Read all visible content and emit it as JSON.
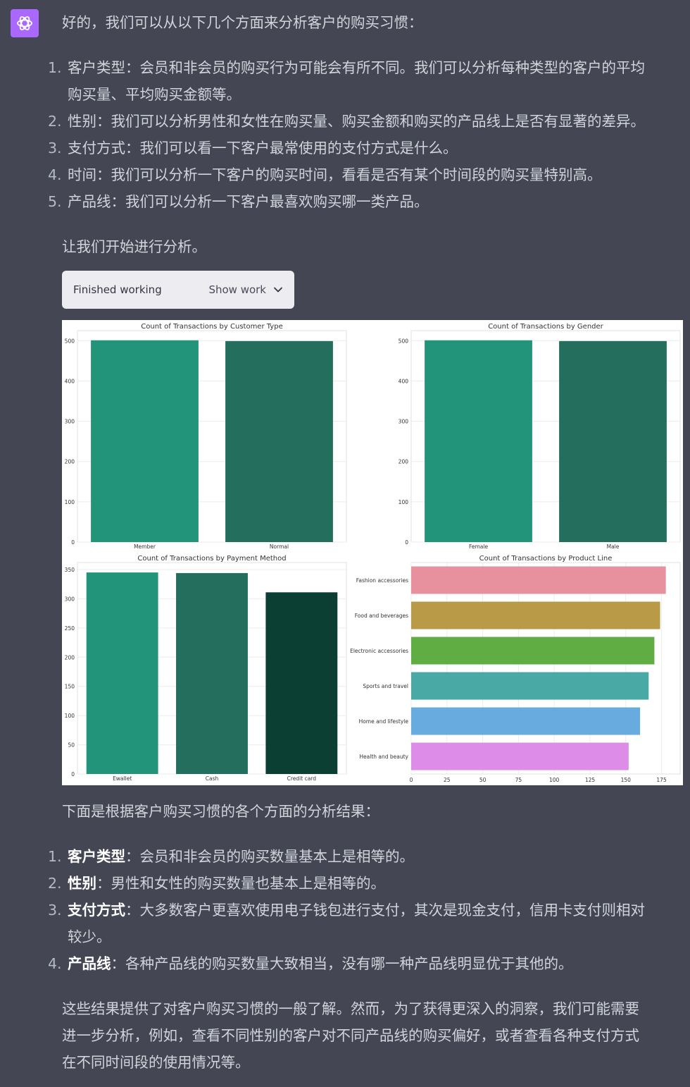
{
  "intro": "好的，我们可以从以下几个方面来分析客户的购买习惯：",
  "aspects": [
    {
      "num": "1.",
      "line1": "客户类型：会员和非会员的购买行为可能会有所不同。我们可以分析每种类型的客户的平均",
      "line2": "购买量、平均购买金额等。"
    },
    {
      "num": "2.",
      "line1": "性别：我们可以分析男性和女性在购买量、购买金额和购买的产品线上是否有显著的差异。"
    },
    {
      "num": "3.",
      "line1": "支付方式：我们可以看一下客户最常使用的支付方式是什么。"
    },
    {
      "num": "4.",
      "line1": "时间：我们可以分析一下客户的购买时间，看看是否有某个时间段的购买量特别高。"
    },
    {
      "num": "5.",
      "line1": "产品线：我们可以分析一下客户最喜欢购买哪一类产品。"
    }
  ],
  "start": "让我们开始进行分析。",
  "work": {
    "status": "Finished working",
    "toggle": "Show work",
    "icon": "chevron-down-icon"
  },
  "chart_data": [
    {
      "type": "bar",
      "title": "Count of Transactions by Customer Type",
      "categories": [
        "Member",
        "Normal"
      ],
      "values": [
        501,
        499
      ],
      "yticks": [
        0,
        100,
        200,
        300,
        400,
        500
      ],
      "ylim": [
        0,
        525
      ],
      "colors": [
        "#22947a",
        "#236e5c"
      ],
      "grid": true
    },
    {
      "type": "bar",
      "title": "Count of Transactions by Gender",
      "categories": [
        "Female",
        "Male"
      ],
      "values": [
        501,
        499
      ],
      "yticks": [
        0,
        100,
        200,
        300,
        400,
        500
      ],
      "ylim": [
        0,
        525
      ],
      "colors": [
        "#22947a",
        "#236e5c"
      ],
      "grid": true
    },
    {
      "type": "bar",
      "title": "Count of Transactions by Payment Method",
      "categories": [
        "Ewallet",
        "Cash",
        "Credit card"
      ],
      "values": [
        345,
        344,
        311
      ],
      "yticks": [
        0,
        50,
        100,
        150,
        200,
        250,
        300,
        350
      ],
      "ylim": [
        0,
        362
      ],
      "colors": [
        "#22947a",
        "#236e5c",
        "#0b3f33"
      ],
      "grid": true
    },
    {
      "type": "bar",
      "orientation": "horizontal",
      "title": "Count of Transactions by Product Line",
      "categories": [
        "Fashion accessories",
        "Food and beverages",
        "Electronic accessories",
        "Sports and travel",
        "Home and lifestyle",
        "Health and beauty"
      ],
      "values": [
        178,
        174,
        170,
        166,
        160,
        152
      ],
      "xticks": [
        0,
        25,
        50,
        75,
        100,
        125,
        150,
        175
      ],
      "xlim": [
        0,
        188
      ],
      "colors": [
        "#e8919e",
        "#b89a47",
        "#5fad43",
        "#49aaa5",
        "#68abdf",
        "#dd8de8"
      ],
      "grid": true
    }
  ],
  "results_intro": "下面是根据客户购买习惯的各个方面的分析结果：",
  "results": [
    {
      "num": "1.",
      "bold": "客户类型",
      "rest": "：会员和非会员的购买数量基本上是相等的。"
    },
    {
      "num": "2.",
      "bold": "性别",
      "rest": "：男性和女性的购买数量也基本上是相等的。"
    },
    {
      "num": "3.",
      "bold": "支付方式",
      "rest": "：大多数客户更喜欢使用电子钱包进行支付，其次是现金支付，信用卡支付则相对",
      "line2": "较少。"
    },
    {
      "num": "4.",
      "bold": "产品线",
      "rest": "：各种产品线的购买数量大致相当，没有哪一种产品线明显优于其他的。"
    }
  ],
  "conclusion": [
    "这些结果提供了对客户购买习惯的一般了解。然而，为了获得更深入的洞察，我们可能需要",
    "进一步分析，例如，查看不同性别的客户对不同产品线的购买偏好，或者查看各种支付方式",
    "在不同时间段的使用情况等。"
  ]
}
